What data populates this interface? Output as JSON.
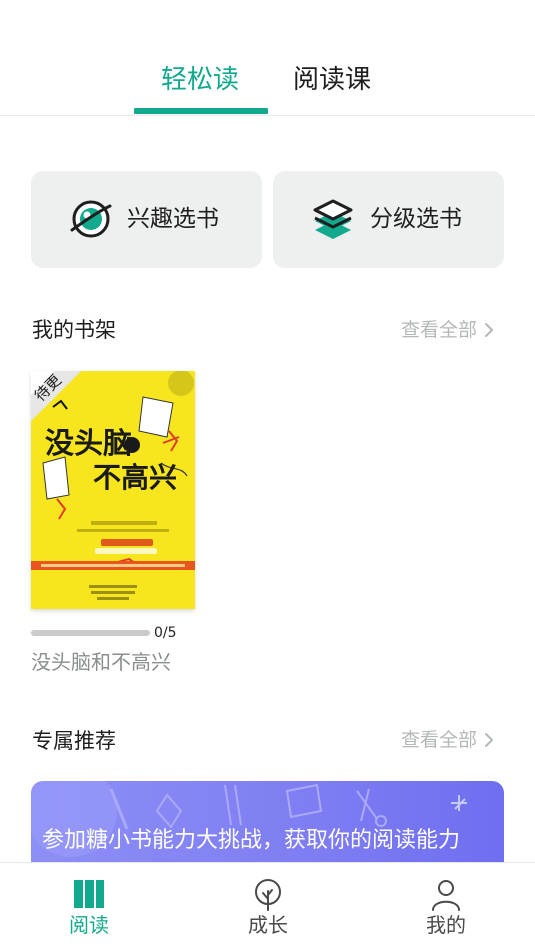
{
  "top_tabs": {
    "easy_read": "轻松读",
    "reading_course": "阅读课"
  },
  "categories": {
    "interest": "兴趣选书",
    "level": "分级选书"
  },
  "bookshelf": {
    "title": "我的书架",
    "see_all": "查看全部",
    "book": {
      "badge": "待更",
      "cover_title": "没头脑和不高兴",
      "progress_text": "0/5",
      "progress": 0,
      "title": "没头脑和不高兴"
    }
  },
  "recommend": {
    "title": "专属推荐",
    "see_all": "查看全部",
    "banner_text": "参加糖小书能力大挑战，获取你的阅读能力"
  },
  "bottom_nav": {
    "read": "阅读",
    "grow": "成长",
    "mine": "我的"
  },
  "colors": {
    "accent": "#12a98e",
    "card_bg": "#edf0ef",
    "banner": "#7e7df2",
    "cover_yellow": "#f7e61d"
  }
}
